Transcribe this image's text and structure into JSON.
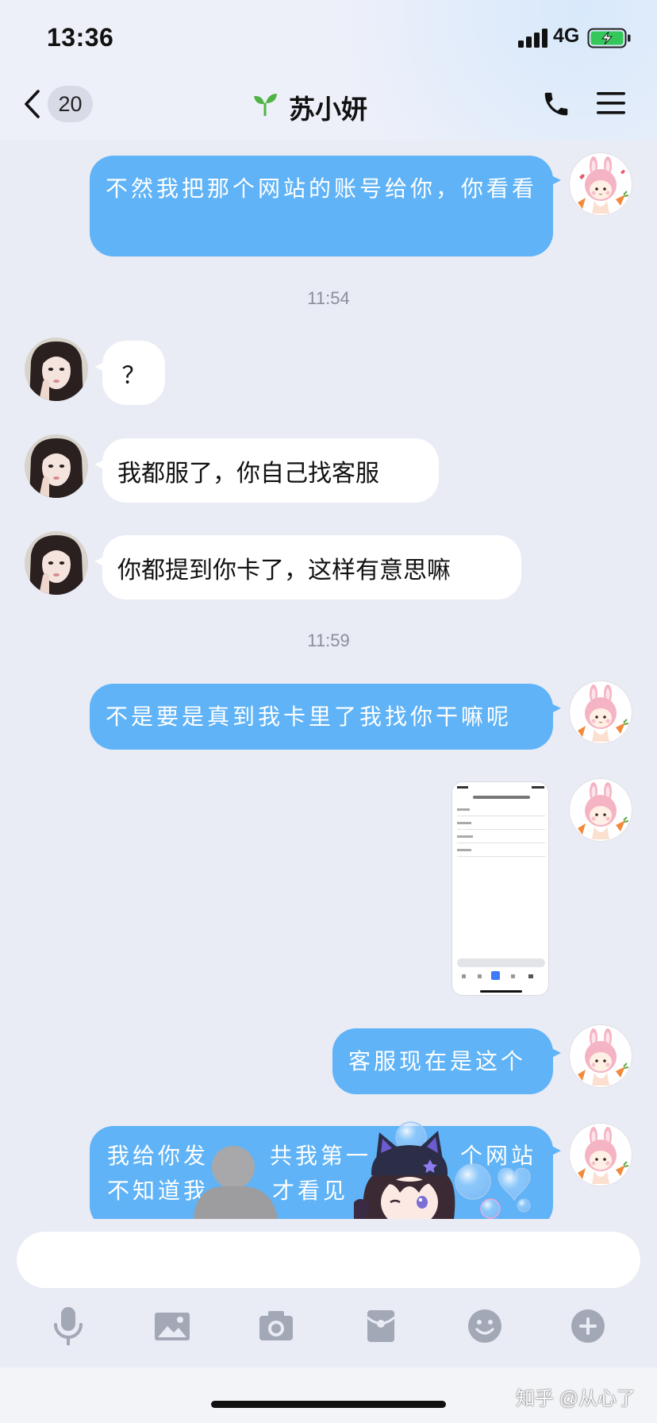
{
  "status_bar": {
    "time": "13:36",
    "network": "4G"
  },
  "header": {
    "unread_count": "20",
    "contact_name": "苏小妍"
  },
  "chat": {
    "timestamps": [
      "11:54",
      "11:59"
    ],
    "outgoing": [
      "不然我把那个网站的账号给你，你看看",
      "不是要是真到我卡里了我找你干嘛呢",
      "客服现在是这个"
    ],
    "incoming": [
      "？",
      "我都服了，你自己找客服",
      "你都提到你卡了，这样有意思嘛"
    ],
    "partial_outgoing": {
      "line1": [
        "我给你发",
        "共我第一",
        "个网站"
      ],
      "line2": [
        "不知道我",
        "才看见"
      ]
    }
  },
  "toolbar": {
    "icons": [
      "mic-icon",
      "image-icon",
      "camera-icon",
      "red-packet-icon",
      "emoji-icon",
      "plus-icon"
    ]
  },
  "watermark": "知乎 @从心了",
  "colors": {
    "outgoing_bubble": "#5fb3f6",
    "incoming_bubble": "#ffffff",
    "chat_background": "#e9ebf5",
    "toolbar_icon": "#a3a8b6",
    "battery": "#34c759",
    "sprout": "#4fb443"
  }
}
